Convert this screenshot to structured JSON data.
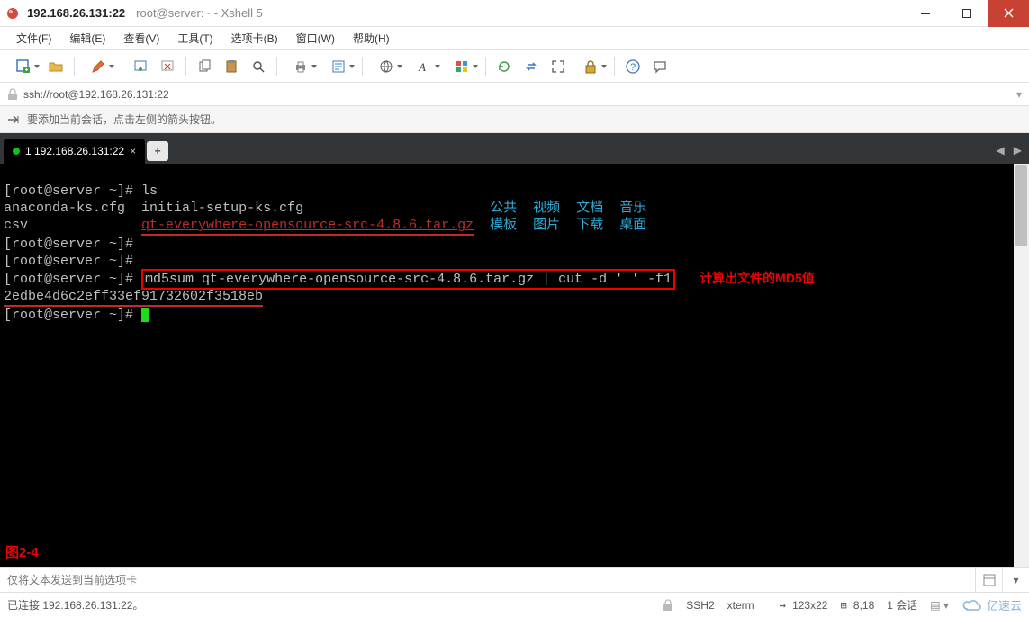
{
  "window": {
    "title_ip": "192.168.26.131:22",
    "title_session": "root@server:~ - Xshell 5"
  },
  "menu": {
    "file": "文件(F)",
    "edit": "编辑(E)",
    "view": "查看(V)",
    "tools": "工具(T)",
    "tab": "选项卡(B)",
    "window_m": "窗口(W)",
    "help": "帮助(H)"
  },
  "toolbar_icons": {
    "new": "new-session-icon",
    "open": "open-icon",
    "pencil": "edit-icon",
    "reconnect": "reconnect-icon",
    "disconnect": "disconnect-icon",
    "copy": "copy-icon",
    "paste": "paste-icon",
    "search_glass": "find-icon",
    "printer": "print-icon",
    "props": "properties-icon",
    "globe": "encoding-icon",
    "font": "font-icon",
    "palette": "color-scheme-icon",
    "refresh": "refresh-icon",
    "xfer": "transfer-icon",
    "fullscreen": "fullscreen-icon",
    "lock": "lock-icon",
    "help_q": "help-icon",
    "chat": "chat-icon"
  },
  "address": {
    "url": "ssh://root@192.168.26.131:22"
  },
  "hint": {
    "text": "要添加当前会话，点击左侧的箭头按钮。"
  },
  "tab": {
    "label": "1 192.168.26.131:22"
  },
  "terminal": {
    "prompt": "[root@server ~]#",
    "cmd_ls": "ls",
    "row1_a": "anaconda-ks.cfg",
    "row1_b": "initial-setup-ks.cfg",
    "col_public": "公共",
    "col_video": "视频",
    "col_docs": "文档",
    "col_music": "音乐",
    "row2_a": "csv",
    "row2_b": "qt-everywhere-opensource-src-4.8.6.tar.gz",
    "col_tmpl": "模板",
    "col_pic": "图片",
    "col_dl": "下载",
    "col_desktop": "桌面",
    "cmd_md5": "md5sum qt-everywhere-opensource-src-4.8.6.tar.gz | cut -d ' ' -f1",
    "md5_value": "2edbe4d6c2eff33ef91732602f3518eb",
    "annotation": "计算出文件的MD5值",
    "figure_label": "图2-4"
  },
  "sendbar": {
    "placeholder": "仅将文本发送到当前选项卡"
  },
  "status": {
    "connected": "已连接 192.168.26.131:22。",
    "proto": "SSH2",
    "term": "xterm",
    "size": "123x22",
    "pos": "8,18",
    "sessions": "1 会话"
  },
  "brand": {
    "name": "亿速云"
  }
}
